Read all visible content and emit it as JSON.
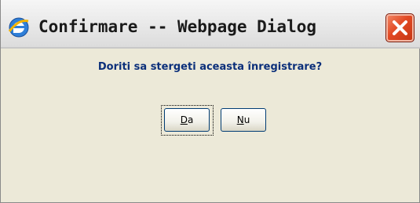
{
  "window": {
    "title": "Confirmare -- Webpage Dialog"
  },
  "dialog": {
    "question": "Doriti sa stergeti aceasta înregistrare?",
    "buttons": {
      "yes": {
        "accel": "D",
        "rest": "a"
      },
      "no": {
        "accel": "N",
        "rest": "u"
      }
    }
  },
  "icons": {
    "app": "internet-explorer-icon",
    "close": "close-icon"
  },
  "colors": {
    "question_text": "#0b2f7a",
    "close_button": "#e24a24",
    "dialog_background": "#ece9d8"
  }
}
